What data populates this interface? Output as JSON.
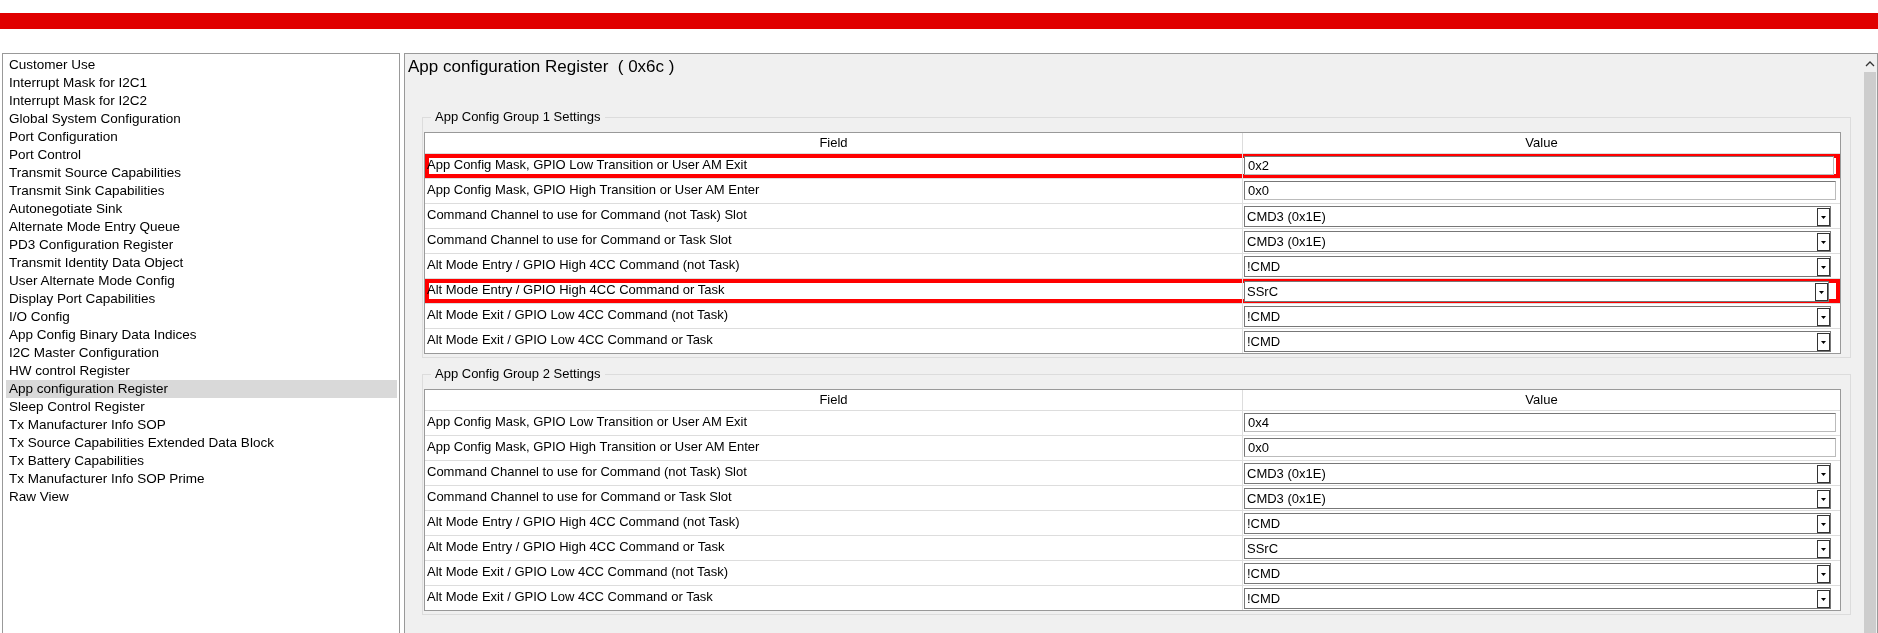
{
  "sidebar": {
    "items": [
      {
        "label": "Customer Use",
        "selected": false
      },
      {
        "label": "Interrupt Mask for I2C1",
        "selected": false
      },
      {
        "label": "Interrupt Mask for I2C2",
        "selected": false
      },
      {
        "label": "Global System Configuration",
        "selected": false
      },
      {
        "label": "Port Configuration",
        "selected": false
      },
      {
        "label": "Port Control",
        "selected": false
      },
      {
        "label": "Transmit Source Capabilities",
        "selected": false
      },
      {
        "label": "Transmit Sink Capabilities",
        "selected": false
      },
      {
        "label": "Autonegotiate Sink",
        "selected": false
      },
      {
        "label": "Alternate Mode Entry Queue",
        "selected": false
      },
      {
        "label": "PD3 Configuration Register",
        "selected": false
      },
      {
        "label": "Transmit Identity Data Object",
        "selected": false
      },
      {
        "label": "User Alternate Mode Config",
        "selected": false
      },
      {
        "label": "Display Port Capabilities",
        "selected": false
      },
      {
        "label": "I/O Config",
        "selected": false
      },
      {
        "label": "App Config Binary Data Indices",
        "selected": false
      },
      {
        "label": "I2C Master Configuration",
        "selected": false
      },
      {
        "label": "HW control Register",
        "selected": false
      },
      {
        "label": "App configuration Register",
        "selected": true
      },
      {
        "label": "Sleep Control Register",
        "selected": false
      },
      {
        "label": "Tx Manufacturer Info SOP",
        "selected": false
      },
      {
        "label": "Tx Source Capabilities Extended Data Block",
        "selected": false
      },
      {
        "label": "Tx Battery Capabilities",
        "selected": false
      },
      {
        "label": "Tx Manufacturer Info SOP Prime",
        "selected": false
      },
      {
        "label": "Raw View",
        "selected": false
      }
    ]
  },
  "panel": {
    "title": "App configuration Register  ( 0x6c )",
    "groups": [
      {
        "title": "App Config Group 1 Settings",
        "columns": [
          "Field",
          "Value"
        ],
        "rows": [
          {
            "field": "App Config Mask, GPIO Low Transition or User AM Exit",
            "kind": "text",
            "value": "0x2",
            "highlighted": true
          },
          {
            "field": "App Config Mask, GPIO High Transition or User AM Enter",
            "kind": "text",
            "value": "0x0",
            "highlighted": false
          },
          {
            "field": "Command Channel to use for Command (not Task) Slot",
            "kind": "dropdown",
            "value": "CMD3 (0x1E)",
            "highlighted": false
          },
          {
            "field": "Command Channel to use for Command or Task Slot",
            "kind": "dropdown",
            "value": "CMD3 (0x1E)",
            "highlighted": false
          },
          {
            "field": "Alt Mode Entry / GPIO High 4CC Command (not Task)",
            "kind": "dropdown",
            "value": "!CMD",
            "highlighted": false
          },
          {
            "field": "Alt Mode Entry / GPIO High 4CC Command or Task",
            "kind": "dropdown",
            "value": "SSrC",
            "highlighted": true
          },
          {
            "field": "Alt Mode Exit / GPIO Low 4CC Command (not Task)",
            "kind": "dropdown",
            "value": "!CMD",
            "highlighted": false
          },
          {
            "field": "Alt Mode Exit / GPIO Low 4CC Command or Task",
            "kind": "dropdown",
            "value": "!CMD",
            "highlighted": false
          }
        ]
      },
      {
        "title": "App Config Group 2 Settings",
        "columns": [
          "Field",
          "Value"
        ],
        "rows": [
          {
            "field": "App Config Mask, GPIO Low Transition or User AM Exit",
            "kind": "text",
            "value": "0x4",
            "highlighted": false
          },
          {
            "field": "App Config Mask, GPIO High Transition or User AM Enter",
            "kind": "text",
            "value": "0x0",
            "highlighted": false
          },
          {
            "field": "Command Channel to use for Command (not Task) Slot",
            "kind": "dropdown",
            "value": "CMD3 (0x1E)",
            "highlighted": false
          },
          {
            "field": "Command Channel to use for Command or Task Slot",
            "kind": "dropdown",
            "value": "CMD3 (0x1E)",
            "highlighted": false
          },
          {
            "field": "Alt Mode Entry / GPIO High 4CC Command (not Task)",
            "kind": "dropdown",
            "value": "!CMD",
            "highlighted": false
          },
          {
            "field": "Alt Mode Entry / GPIO High 4CC Command or Task",
            "kind": "dropdown",
            "value": "SSrC",
            "highlighted": false
          },
          {
            "field": "Alt Mode Exit / GPIO Low 4CC Command (not Task)",
            "kind": "dropdown",
            "value": "!CMD",
            "highlighted": false
          },
          {
            "field": "Alt Mode Exit / GPIO Low 4CC Command or Task",
            "kind": "dropdown",
            "value": "!CMD",
            "highlighted": false
          }
        ]
      }
    ]
  }
}
